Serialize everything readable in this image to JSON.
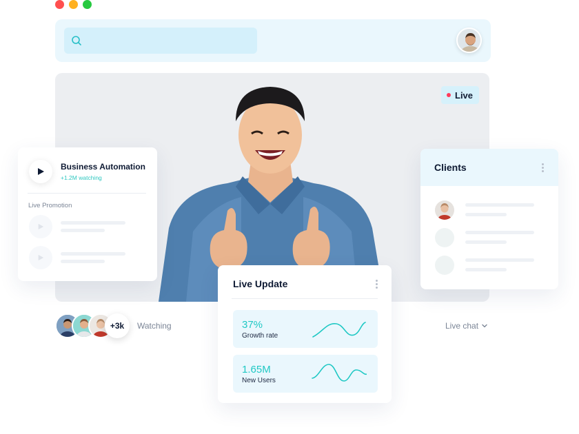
{
  "window": {
    "controls": [
      "#ff4f4f",
      "#ffb020",
      "#27c940"
    ]
  },
  "header": {
    "search_icon": "search-icon",
    "avatar": "user-avatar"
  },
  "video": {
    "live_label": "Live",
    "live_color": "#ff3b5c"
  },
  "left_card": {
    "title": "Business Automation",
    "subtitle": "+1.2M watching",
    "section_label": "Live Promotion"
  },
  "clients": {
    "title": "Clients"
  },
  "live_update": {
    "title": "Live Update",
    "stats": [
      {
        "value": "37%",
        "label": "Growth rate"
      },
      {
        "value": "1.65M",
        "label": "New Users"
      }
    ]
  },
  "footer": {
    "viewer_count": "+3k",
    "watching_label": "Watching",
    "live_chat_label": "Live chat"
  },
  "colors": {
    "accent": "#1fc8c4",
    "panel_bg": "#eaf7fd",
    "text_dark": "#0e1a33"
  }
}
